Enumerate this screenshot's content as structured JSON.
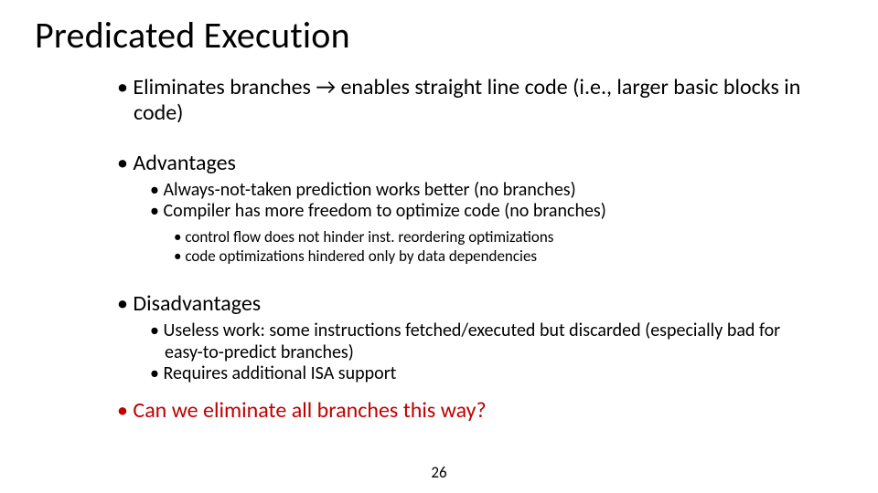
{
  "title": "Predicated Execution",
  "bullets": {
    "intro": "Eliminates branches → enables straight line code (i.e., larger basic blocks in code)",
    "advantages": {
      "heading": "Advantages",
      "items": [
        "Always-not-taken prediction works better (no branches)",
        "Compiler has more freedom to optimize code (no branches)"
      ],
      "subitems": [
        "control flow does not hinder inst. reordering optimizations",
        "code optimizations hindered only by data dependencies"
      ]
    },
    "disadvantages": {
      "heading": "Disadvantages",
      "items": [
        "Useless work: some instructions fetched/executed but discarded (especially bad for easy-to-predict branches)",
        "Requires additional ISA support"
      ]
    },
    "closing": "Can we eliminate all branches this way?"
  },
  "page_number": "26"
}
